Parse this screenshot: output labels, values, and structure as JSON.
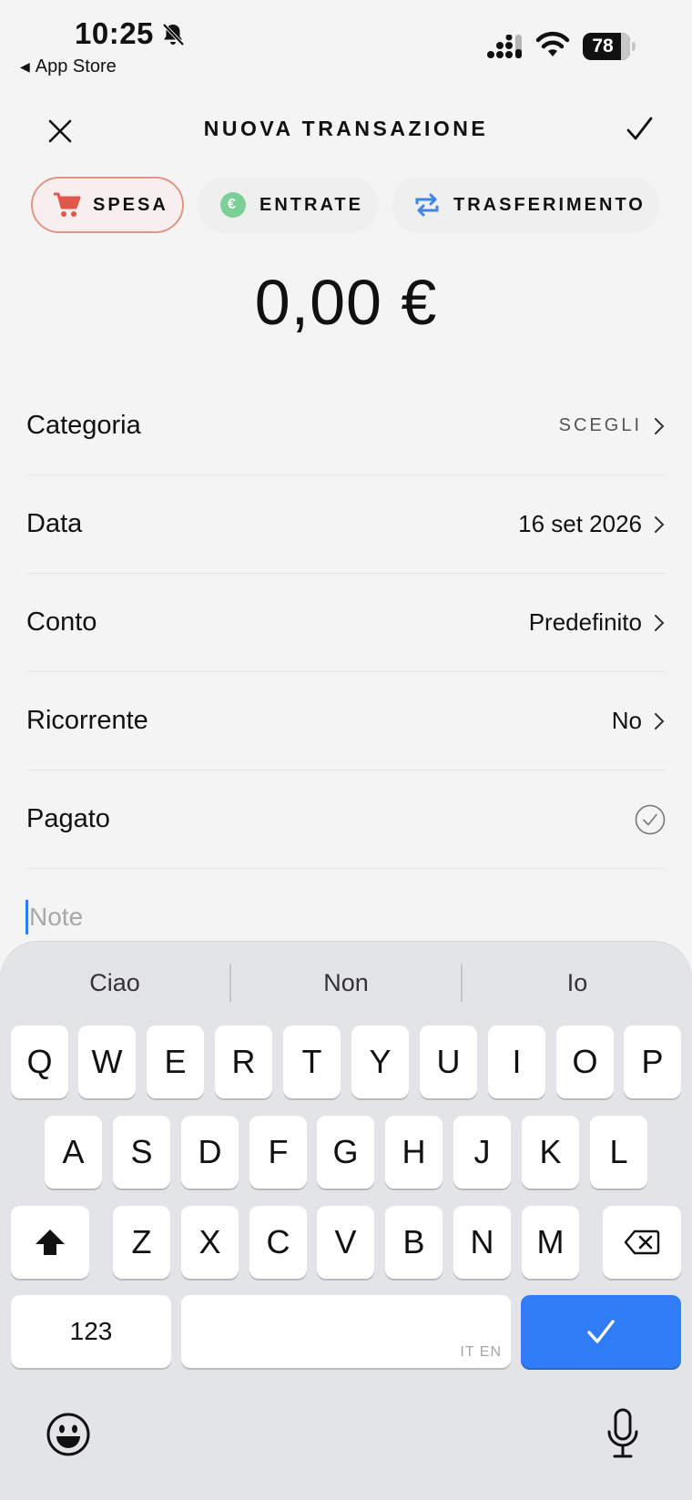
{
  "status_bar": {
    "time": "10:25",
    "back_app": "App Store",
    "battery": "78"
  },
  "header": {
    "title": "NUOVA TRANSAZIONE"
  },
  "type_segments": [
    {
      "label": "SPESA",
      "icon": "cart-icon",
      "active": true,
      "accent": "#e39585"
    },
    {
      "label": "ENTRATE",
      "icon": "euro-icon",
      "active": false,
      "accent": "#7ccf97"
    },
    {
      "label": "TRASFERIMENTO",
      "icon": "transfer-icon",
      "active": false,
      "accent": "#3c86e8"
    }
  ],
  "amount": "0,00 €",
  "form": {
    "rows": [
      {
        "label": "Categoria",
        "value": "SCEGLI"
      },
      {
        "label": "Data",
        "value": "16 set 2026"
      },
      {
        "label": "Conto",
        "value": "Predefinito"
      },
      {
        "label": "Ricorrente",
        "value": "No"
      },
      {
        "label": "Pagato",
        "value": ""
      }
    ],
    "note_placeholder": "Note"
  },
  "keyboard": {
    "suggestions": [
      "Ciao",
      "Non",
      "Io"
    ],
    "row1": [
      "Q",
      "W",
      "E",
      "R",
      "T",
      "Y",
      "U",
      "I",
      "O",
      "P"
    ],
    "row2": [
      "A",
      "S",
      "D",
      "F",
      "G",
      "H",
      "J",
      "K",
      "L"
    ],
    "row3": [
      "Z",
      "X",
      "C",
      "V",
      "B",
      "N",
      "M"
    ],
    "numbers_label": "123",
    "space_lang": "IT EN",
    "accent": "#2f7cf6"
  }
}
